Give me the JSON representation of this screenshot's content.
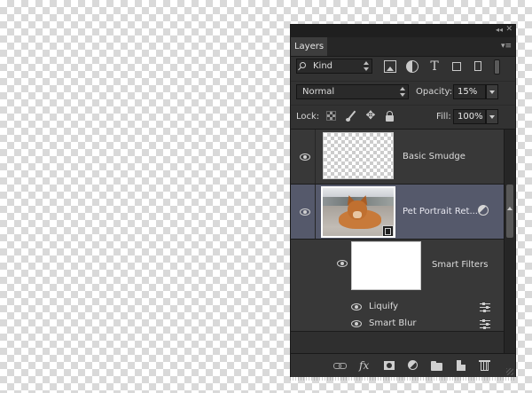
{
  "panel": {
    "collapse_glyph": "◂◂",
    "close_glyph": "✕",
    "menu_glyph": "▾≡",
    "tab_label": "Layers"
  },
  "filter": {
    "kind_label": "Kind",
    "type_glyph": "T",
    "icons": [
      "pixel-filter-icon",
      "adjustment-filter-icon",
      "type-filter-icon",
      "shape-filter-icon",
      "smart-object-filter-icon"
    ]
  },
  "blend": {
    "mode": "Normal",
    "opacity_label": "Opacity:",
    "opacity_value": "15%"
  },
  "lock": {
    "label": "Lock:",
    "move_glyph": "✥",
    "fill_label": "Fill:",
    "fill_value": "100%"
  },
  "layers": [
    {
      "name": "Basic Smudge",
      "selected": false,
      "visible": true
    },
    {
      "name": "Pet Portrait Ret...",
      "selected": true,
      "visible": true,
      "smart_object": true
    },
    {
      "name": "Smart Filters",
      "visible": true,
      "is_smart_filters": true
    },
    {
      "name": "Liquify",
      "visible": true,
      "is_filter": true
    },
    {
      "name": "Smart Blur",
      "visible": true,
      "is_filter": true
    }
  ],
  "bottom": {
    "fx_label": "fx",
    "icons": [
      "link-icon",
      "fx-icon",
      "mask-icon",
      "adjustment-layer-icon",
      "group-icon",
      "new-layer-icon",
      "trash-icon"
    ]
  },
  "colors": {
    "panel_bg": "#323232",
    "selected_row": "#55596b",
    "row_bg": "#383838"
  }
}
